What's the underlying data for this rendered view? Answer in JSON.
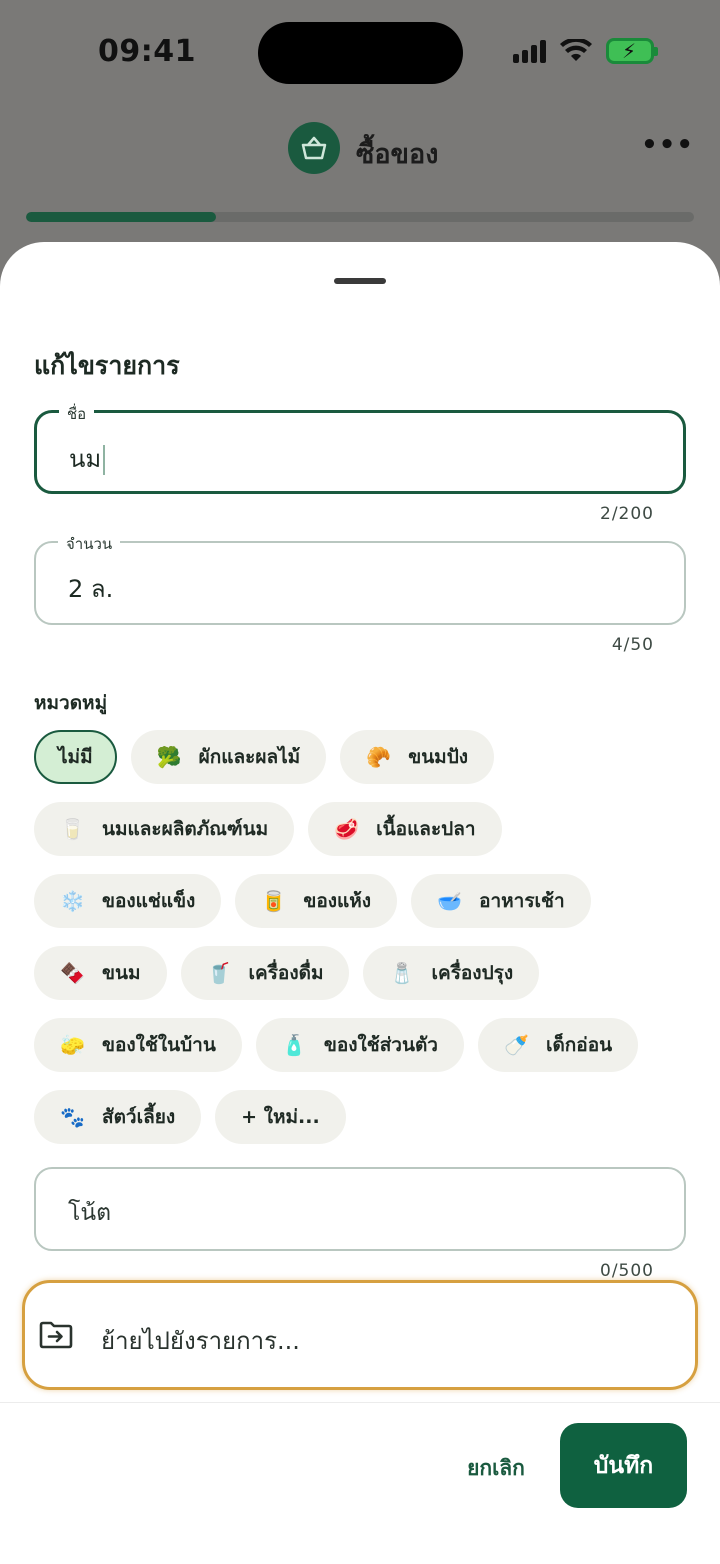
{
  "status_bar": {
    "time": "09:41"
  },
  "app_header": {
    "title": "ซื้อของ",
    "icon": "basket-icon",
    "more_icon": "•••"
  },
  "progress": {
    "fraction": 0.285
  },
  "sheet": {
    "title": "แก้ไขรายการ",
    "name_field": {
      "label": "ชื่อ",
      "value": "นม",
      "counter": "2/200"
    },
    "quantity_field": {
      "label": "จำนวน",
      "value": "2 ล.",
      "counter": "4/50"
    },
    "category_label": "หมวดหมู่",
    "categories": [
      {
        "label": "ไม่มี",
        "emoji": "",
        "selected": true
      },
      {
        "label": "ผักและผลไม้",
        "emoji": "🥦"
      },
      {
        "label": "ขนมปัง",
        "emoji": "🥐"
      },
      {
        "label": "นมและผลิตภัณฑ์นม",
        "emoji": "🥛"
      },
      {
        "label": "เนื้อและปลา",
        "emoji": "🥩"
      },
      {
        "label": "ของแช่แข็ง",
        "emoji": "❄️"
      },
      {
        "label": "ของแห้ง",
        "emoji": "🥫"
      },
      {
        "label": "อาหารเช้า",
        "emoji": "🥣"
      },
      {
        "label": "ขนม",
        "emoji": "🍫"
      },
      {
        "label": "เครื่องดื่ม",
        "emoji": "🥤"
      },
      {
        "label": "เครื่องปรุง",
        "emoji": "🧂"
      },
      {
        "label": "ของใช้ในบ้าน",
        "emoji": "🧽"
      },
      {
        "label": "ของใช้ส่วนตัว",
        "emoji": "🧴"
      },
      {
        "label": "เด็กอ่อน",
        "emoji": "🍼"
      },
      {
        "label": "สัตว์เลี้ยง",
        "emoji": "🐾"
      },
      {
        "label": "+ ใหม่...",
        "emoji": ""
      }
    ],
    "note_field": {
      "placeholder": "โน้ต",
      "counter": "0/500"
    },
    "move_to_list": {
      "label": "ย้ายไปยังรายการ...",
      "icon": "folder-move-icon"
    },
    "actions": {
      "cancel": "ยกเลิก",
      "save": "บันทึก"
    }
  },
  "colors": {
    "primary": "#0f6140",
    "selected_chip": "#d4eed4",
    "highlight": "#d6a040"
  }
}
